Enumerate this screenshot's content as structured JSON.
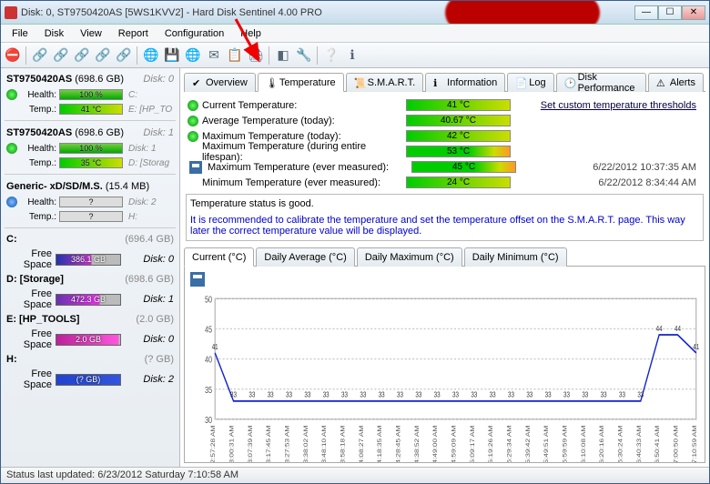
{
  "title": "Disk: 0, ST9750420AS [5WS1KVV2]  -  Hard Disk Sentinel 4.00 PRO",
  "menu": [
    "File",
    "Disk",
    "View",
    "Report",
    "Configuration",
    "Help"
  ],
  "tabs": [
    {
      "label": "Overview",
      "icon": "check"
    },
    {
      "label": "Temperature",
      "icon": "thermo",
      "active": true
    },
    {
      "label": "S.M.A.R.T.",
      "icon": "scroll"
    },
    {
      "label": "Information",
      "icon": "info"
    },
    {
      "label": "Log",
      "icon": "log"
    },
    {
      "label": "Disk Performance",
      "icon": "clock"
    },
    {
      "label": "Alerts",
      "icon": "alert"
    }
  ],
  "sidebar": {
    "disks": [
      {
        "name": "ST9750420AS",
        "size": "(698.6 GB)",
        "tag": "Disk: 0",
        "health": "100 %",
        "temp": "41 °C",
        "drives": "C:",
        "drives2": "E: [HP_TO"
      },
      {
        "name": "ST9750420AS",
        "size": "(698.6 GB)",
        "tag": "Disk: 1",
        "health": "100 %",
        "temp": "35 °C",
        "drives": "Disk: 1",
        "drives2": "D: [Storag"
      },
      {
        "name": "Generic- xD/SD/M.S.",
        "size": "(15.4 MB)",
        "tag": "",
        "health": "?",
        "temp": "?",
        "drives": "Disk: 2",
        "drives2": "H:",
        "unknown": true
      }
    ],
    "volumes": [
      {
        "letter": "C:",
        "cap": "(696.4 GB)",
        "tag": "Disk: 0",
        "free": "386.1 GB",
        "pct": 55,
        "c1": "#2233aa",
        "c2": "#cc33cc"
      },
      {
        "letter": "D: [Storage]",
        "cap": "(698.6 GB)",
        "tag": "Disk: 1",
        "free": "472.3 GB",
        "pct": 68,
        "c1": "#6633aa",
        "c2": "#ee33ee"
      },
      {
        "letter": "E: [HP_TOOLS]",
        "cap": "(2.0 GB)",
        "tag": "Disk: 0",
        "free": "2.0 GB",
        "pct": 98,
        "c1": "#bb2299",
        "c2": "#ff55dd"
      },
      {
        "letter": "H:",
        "cap": "(? GB)",
        "tag": "Disk: 2",
        "free": "(? GB)",
        "pct": 100,
        "c1": "#2244cc",
        "c2": "#3355dd"
      }
    ]
  },
  "temps": [
    {
      "label": "Current Temperature:",
      "val": "41 °C",
      "led": true,
      "link": "Set custom temperature thresholds",
      "bar": "g"
    },
    {
      "label": "Average Temperature (today):",
      "val": "40.67 °C",
      "led": true,
      "bar": "g"
    },
    {
      "label": "Maximum Temperature (today):",
      "val": "42 °C",
      "led": true,
      "bar": "g"
    },
    {
      "label": "Maximum Temperature (during entire lifespan):",
      "val": "53 °C",
      "bar": "o"
    },
    {
      "label": "Maximum Temperature (ever measured):",
      "val": "45 °C",
      "icon": "save",
      "right": "6/22/2012 10:37:35 AM",
      "bar": "o"
    },
    {
      "label": "Minimum Temperature (ever measured):",
      "val": "24 °C",
      "right": "6/22/2012 8:34:44 AM",
      "bar": "g"
    }
  ],
  "status": {
    "line1": "Temperature status is good.",
    "line2": "It is recommended to calibrate the temperature and set the temperature offset on the S.M.A.R.T. page. This way later the correct temperature value will be displayed."
  },
  "subtabs": [
    "Current (°C)",
    "Daily Average (°C)",
    "Daily Maximum (°C)",
    "Daily Minimum (°C)"
  ],
  "chart_data": {
    "type": "line",
    "title": "",
    "ylabel": "",
    "ylim": [
      30,
      50
    ],
    "yticks": [
      30,
      35,
      40,
      45,
      50
    ],
    "x_times": [
      "2:57:28 AM",
      "3:00:31 AM",
      "3:07:39 AM",
      "3:17:45 AM",
      "3:27:53 AM",
      "3:38:02 AM",
      "3:48:10 AM",
      "3:58:18 AM",
      "4:08:27 AM",
      "4:18:35 AM",
      "4:28:45 AM",
      "4:38:52 AM",
      "4:49:00 AM",
      "4:59:09 AM",
      "5:09:17 AM",
      "5:19:26 AM",
      "5:29:34 AM",
      "5:39:42 AM",
      "5:49:51 AM",
      "5:59:59 AM",
      "6:10:08 AM",
      "6:20:16 AM",
      "6:30:24 AM",
      "6:40:33 AM",
      "6:50:41 AM",
      "7:00:50 AM",
      "7:10:59 AM"
    ],
    "values": [
      41,
      33,
      33,
      33,
      33,
      33,
      33,
      33,
      33,
      33,
      33,
      33,
      33,
      33,
      33,
      33,
      33,
      33,
      33,
      33,
      33,
      33,
      33,
      33,
      44,
      44,
      41
    ]
  },
  "statusbar": "Status last updated: 6/23/2012 Saturday 7:10:58 AM"
}
